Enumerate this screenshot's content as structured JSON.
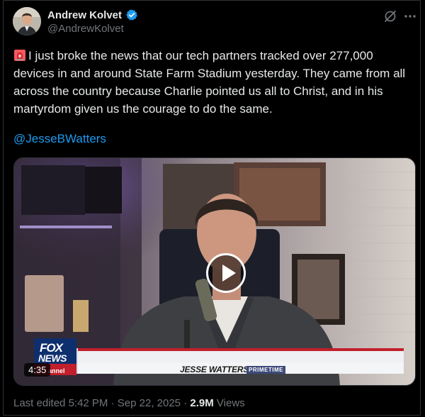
{
  "author": {
    "name": "Andrew Kolvet",
    "handle": "@AndrewKolvet",
    "verified": true,
    "verified_color": "#1d9bf0"
  },
  "actions": {
    "grok_icon": "grok-icon",
    "more_icon": "more-icon"
  },
  "tweet": {
    "siren_emoji": "siren-icon",
    "text": "I just broke the news that our tech partners tracked over 277,000 devices in and around State Farm Stadium yesterday. They came from all across the country because Charlie pointed us all to Christ, and in his martyrdom given us the courage to do the same.",
    "mention": "@JesseBWatters"
  },
  "media": {
    "type": "video",
    "duration": "4:35",
    "logo_line1": "FOX",
    "logo_line2": "NEWS",
    "logo_line3": "annel",
    "chyron_name": "JESSE WATTERS",
    "chyron_show": "PRIMETIME"
  },
  "meta": {
    "edited_label": "Last edited",
    "time": "5:42 PM",
    "separator": "·",
    "date": "Sep 22, 2025",
    "views_count": "2.9M",
    "views_label": "Views"
  },
  "colors": {
    "background": "#000000",
    "text": "#e7e9ea",
    "muted": "#71767b",
    "link": "#1d9bf0"
  }
}
